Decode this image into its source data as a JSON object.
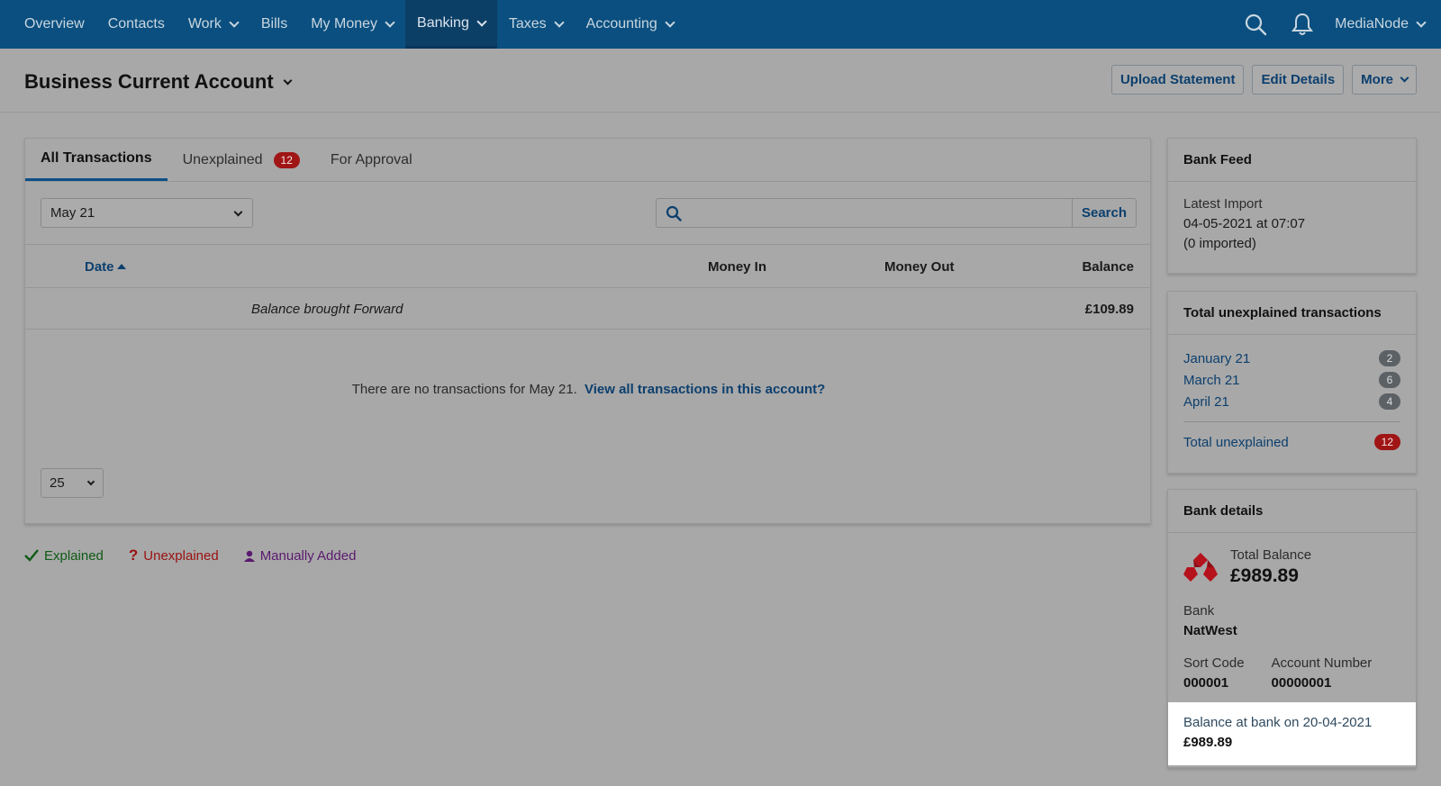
{
  "nav": {
    "items": [
      {
        "label": "Overview",
        "has_menu": false
      },
      {
        "label": "Contacts",
        "has_menu": false
      },
      {
        "label": "Work",
        "has_menu": true
      },
      {
        "label": "Bills",
        "has_menu": false
      },
      {
        "label": "My Money",
        "has_menu": true
      },
      {
        "label": "Banking",
        "has_menu": true,
        "active": true
      },
      {
        "label": "Taxes",
        "has_menu": true
      },
      {
        "label": "Accounting",
        "has_menu": true
      }
    ],
    "user": "MediaNode",
    "search_icon": "search-icon",
    "notification_icon": "bell-icon"
  },
  "header": {
    "title": "Business Current Account",
    "buttons": {
      "upload": "Upload Statement",
      "edit": "Edit Details",
      "more": "More"
    }
  },
  "main": {
    "tabs": {
      "all": "All Transactions",
      "unexplained": "Unexplained",
      "unexplained_count": "12",
      "approval": "For Approval"
    },
    "month_select": "May 21",
    "search": {
      "placeholder": "",
      "button": "Search"
    },
    "columns": {
      "date": "Date",
      "money_in": "Money In",
      "money_out": "Money Out",
      "balance": "Balance"
    },
    "brought_forward": {
      "label": "Balance brought Forward",
      "amount": "£109.89"
    },
    "empty": {
      "text": "There are no transactions for May 21.",
      "link": "View all transactions in this account?"
    },
    "page_size": "25"
  },
  "legend": {
    "explained": "Explained",
    "unexplained": "Unexplained",
    "manual": "Manually Added"
  },
  "sidebar": {
    "bank_feed": {
      "title": "Bank Feed",
      "latest_label": "Latest Import",
      "latest_value": "04-05-2021 at 07:07",
      "imported": "(0 imported)"
    },
    "unexplained": {
      "title": "Total unexplained transactions",
      "months": [
        {
          "label": "January 21",
          "count": "2"
        },
        {
          "label": "March 21",
          "count": "6"
        },
        {
          "label": "April 21",
          "count": "4"
        }
      ],
      "total_label": "Total unexplained",
      "total_count": "12"
    },
    "bank_details": {
      "title": "Bank details",
      "total_balance_label": "Total Balance",
      "total_balance": "£989.89",
      "bank_label": "Bank",
      "bank": "NatWest",
      "sort_code_label": "Sort Code",
      "sort_code": "000001",
      "account_number_label": "Account Number",
      "account_number": "00000001",
      "bank_balance_label": "Balance at bank on 20-04-2021",
      "bank_balance": "£989.89"
    }
  },
  "colors": {
    "nav_bg": "#0a4f7f",
    "overlay_bg": "#a8a8a8",
    "link": "#0c3f6e",
    "badge_red": "#a01515",
    "natwest_red": "#c8102e"
  }
}
